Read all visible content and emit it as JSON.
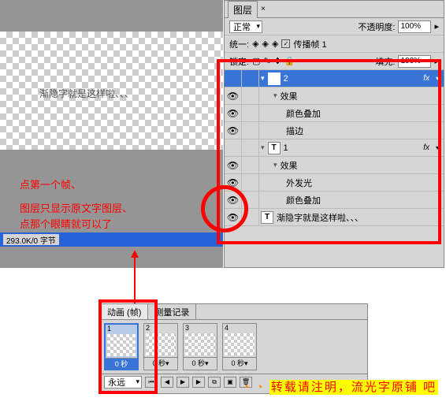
{
  "canvas": {
    "text": "渐隐字就是这样啦、、、"
  },
  "annotations": {
    "line1": "点第一个帧、",
    "line2": "图层只显示原文字图层、",
    "line3": "点那个眼睛就可以了"
  },
  "status": {
    "text": "293.0K/0 字节"
  },
  "layers_panel": {
    "tab": "图层",
    "blend_label": "正常",
    "opacity_label": "不透明度:",
    "opacity_value": "100%",
    "unify_label": "统一:",
    "propagate_label": "传播帧 1",
    "lock_label": "锁定:",
    "fill_label": "填充:",
    "fill_value": "100%",
    "layers": [
      {
        "name": "2",
        "fx": "fx"
      },
      {
        "name": "效果"
      },
      {
        "name": "颜色叠加"
      },
      {
        "name": "描边"
      },
      {
        "name": "1",
        "fx": "fx"
      },
      {
        "name": "效果"
      },
      {
        "name": "外发光"
      },
      {
        "name": "颜色叠加"
      },
      {
        "name": "渐隐字就是这样啦、、、"
      }
    ]
  },
  "animation": {
    "tab1": "动画 (帧)",
    "tab2": "测量记录",
    "frames": [
      {
        "num": "1",
        "delay": "0 秒"
      },
      {
        "num": "2",
        "delay": "0 秒▾"
      },
      {
        "num": "3",
        "delay": "0 秒▾"
      },
      {
        "num": "4",
        "delay": "0 秒▾"
      }
    ],
    "loop": "永远"
  },
  "watermark": {
    "text": "转载请注明，流光字原铺 吧"
  }
}
